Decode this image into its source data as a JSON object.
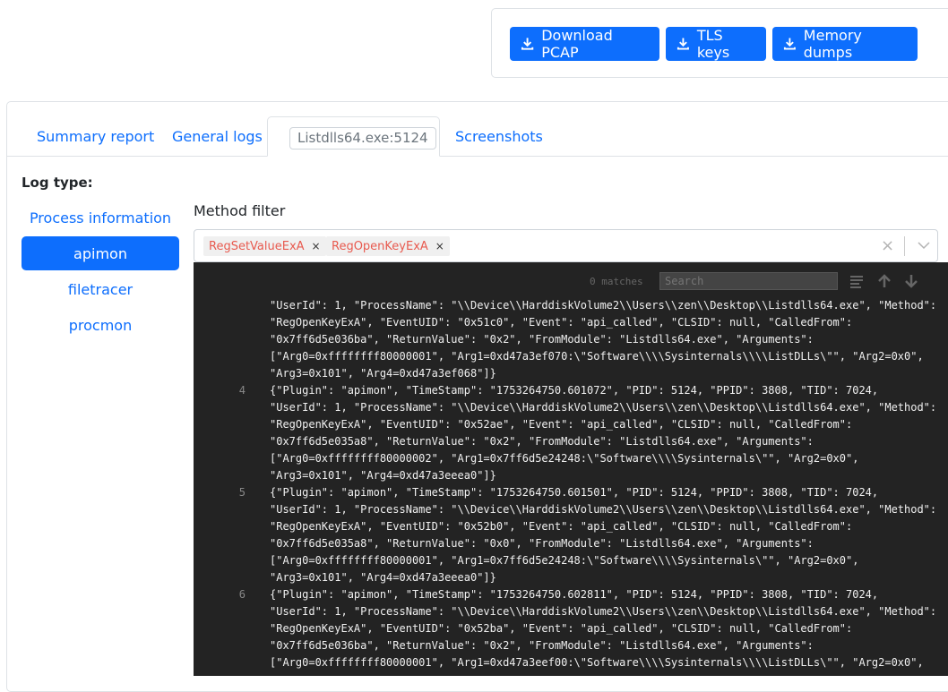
{
  "toolbar": {
    "download_pcap": "Download PCAP",
    "tls_keys": "TLS keys",
    "memory_dumps": "Memory dumps"
  },
  "tabs": {
    "summary": "Summary report",
    "general_logs": "General logs",
    "process_tab": "Listdlls64.exe:5124",
    "screenshots": "Screenshots"
  },
  "sidebar": {
    "title": "Log type:",
    "items": [
      "Process information",
      "apimon",
      "filetracer",
      "procmon"
    ],
    "active": "apimon"
  },
  "filter": {
    "label": "Method filter",
    "tags": [
      "RegSetValueExA",
      "RegOpenKeyExA"
    ],
    "tag_remove": "×",
    "clear": "×"
  },
  "viewer": {
    "matches": "0 matches",
    "search_placeholder": "Search",
    "lines": [
      {
        "num": "",
        "rows": [
          "\"UserId\": 1, \"ProcessName\": \"\\\\Device\\\\HarddiskVolume2\\\\Users\\\\zen\\\\Desktop\\\\Listdlls64.exe\", \"Method\":",
          "\"RegOpenKeyExA\", \"EventUID\": \"0x51c0\", \"Event\": \"api_called\", \"CLSID\": null, \"CalledFrom\":",
          "\"0x7ff6d5e036ba\", \"ReturnValue\": \"0x2\", \"FromModule\": \"Listdlls64.exe\", \"Arguments\":",
          "[\"Arg0=0xffffffff80000001\", \"Arg1=0xd47a3ef070:\\\"Software\\\\\\\\Sysinternals\\\\\\\\ListDLLs\\\"\", \"Arg2=0x0\",",
          "\"Arg3=0x101\", \"Arg4=0xd47a3ef068\"]}"
        ]
      },
      {
        "num": "4",
        "rows": [
          "{\"Plugin\": \"apimon\", \"TimeStamp\": \"1753264750.601072\", \"PID\": 5124, \"PPID\": 3808, \"TID\": 7024,",
          "\"UserId\": 1, \"ProcessName\": \"\\\\Device\\\\HarddiskVolume2\\\\Users\\\\zen\\\\Desktop\\\\Listdlls64.exe\", \"Method\":",
          "\"RegOpenKeyExA\", \"EventUID\": \"0x52ae\", \"Event\": \"api_called\", \"CLSID\": null, \"CalledFrom\":",
          "\"0x7ff6d5e035a8\", \"ReturnValue\": \"0x2\", \"FromModule\": \"Listdlls64.exe\", \"Arguments\":",
          "[\"Arg0=0xffffffff80000002\", \"Arg1=0x7ff6d5e24248:\\\"Software\\\\\\\\Sysinternals\\\"\", \"Arg2=0x0\",",
          "\"Arg3=0x101\", \"Arg4=0xd47a3eeea0\"]}"
        ]
      },
      {
        "num": "5",
        "rows": [
          "{\"Plugin\": \"apimon\", \"TimeStamp\": \"1753264750.601501\", \"PID\": 5124, \"PPID\": 3808, \"TID\": 7024,",
          "\"UserId\": 1, \"ProcessName\": \"\\\\Device\\\\HarddiskVolume2\\\\Users\\\\zen\\\\Desktop\\\\Listdlls64.exe\", \"Method\":",
          "\"RegOpenKeyExA\", \"EventUID\": \"0x52b0\", \"Event\": \"api_called\", \"CLSID\": null, \"CalledFrom\":",
          "\"0x7ff6d5e035a8\", \"ReturnValue\": \"0x0\", \"FromModule\": \"Listdlls64.exe\", \"Arguments\":",
          "[\"Arg0=0xffffffff80000001\", \"Arg1=0x7ff6d5e24248:\\\"Software\\\\\\\\Sysinternals\\\"\", \"Arg2=0x0\",",
          "\"Arg3=0x101\", \"Arg4=0xd47a3eeea0\"]}"
        ]
      },
      {
        "num": "6",
        "rows": [
          "{\"Plugin\": \"apimon\", \"TimeStamp\": \"1753264750.602811\", \"PID\": 5124, \"PPID\": 3808, \"TID\": 7024,",
          "\"UserId\": 1, \"ProcessName\": \"\\\\Device\\\\HarddiskVolume2\\\\Users\\\\zen\\\\Desktop\\\\Listdlls64.exe\", \"Method\":",
          "\"RegOpenKeyExA\", \"EventUID\": \"0x52ba\", \"Event\": \"api_called\", \"CLSID\": null, \"CalledFrom\":",
          "\"0x7ff6d5e036ba\", \"ReturnValue\": \"0x2\", \"FromModule\": \"Listdlls64.exe\", \"Arguments\":",
          "[\"Arg0=0xffffffff80000001\", \"Arg1=0xd47a3eef00:\\\"Software\\\\\\\\Sysinternals\\\\\\\\ListDLLs\\\"\", \"Arg2=0x0\","
        ]
      }
    ]
  }
}
